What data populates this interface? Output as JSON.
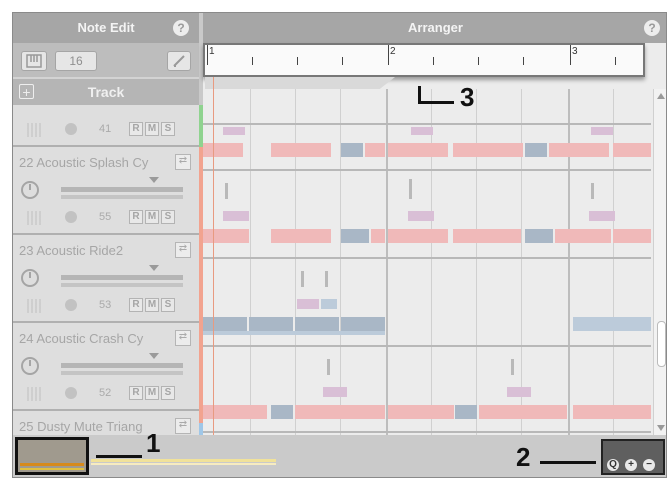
{
  "note_edit": {
    "title": "Note Edit",
    "help": "?",
    "grid_value": "16",
    "pencil_icon": "pencil-icon",
    "grid_icon": "piano-grid-icon"
  },
  "arranger": {
    "title": "Arranger",
    "help": "?"
  },
  "track_header": {
    "add": "+",
    "label": "Track"
  },
  "tracks": [
    {
      "name": "(^ ^)",
      "volume": "41",
      "r": "R",
      "m": "M",
      "s": "S",
      "color": "#8fd38f"
    },
    {
      "name": "22 Acoustic Splash Cy",
      "volume": "55",
      "r": "R",
      "m": "M",
      "s": "S",
      "color": "#f2a38f"
    },
    {
      "name": "23 Acoustic Ride2",
      "volume": "53",
      "r": "R",
      "m": "M",
      "s": "S",
      "color": "#f2a38f"
    },
    {
      "name": "24 Acoustic Crash Cy",
      "volume": "52",
      "r": "R",
      "m": "M",
      "s": "S",
      "color": "#f2a38f"
    },
    {
      "name": "25 Dusty Mute Triang",
      "volume": "",
      "r": "",
      "m": "",
      "s": "",
      "color": "#9fc7e8"
    }
  ],
  "ruler": {
    "marks": [
      "1",
      "2",
      "3"
    ]
  },
  "zoom": {
    "search": "Q",
    "plus": "+",
    "minus": "−"
  },
  "callouts": {
    "c1": "1",
    "c2": "2",
    "c3": "3"
  }
}
